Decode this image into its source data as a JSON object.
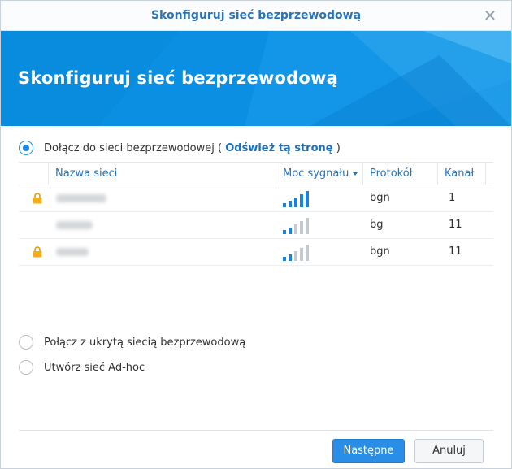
{
  "window": {
    "title": "Skonfiguruj sieć bezprzewodową",
    "close_glyph": "✕"
  },
  "banner": {
    "title": "Skonfiguruj sieć bezprzewodową"
  },
  "options": {
    "join": {
      "label": "Dołącz do sieci bezprzewodowej",
      "paren_open": "(",
      "refresh_link": "Odśwież tą stronę",
      "paren_close": ")",
      "checked": true
    },
    "hidden": {
      "label": "Połącz z ukrytą siecią bezprzewodową",
      "checked": false
    },
    "adhoc": {
      "label": "Utwórz sieć Ad-hoc",
      "checked": false
    }
  },
  "table": {
    "headers": {
      "name": "Nazwa sieci",
      "signal": "Moc sygnału",
      "protocol": "Protokół",
      "channel": "Kanał"
    },
    "rows": [
      {
        "locked": true,
        "signal_bars": 5,
        "protocol": "bgn",
        "channel": "1"
      },
      {
        "locked": false,
        "signal_bars": 2,
        "protocol": "bg",
        "channel": "11"
      },
      {
        "locked": true,
        "signal_bars": 2,
        "protocol": "bgn",
        "channel": "11"
      }
    ]
  },
  "buttons": {
    "next": "Następne",
    "cancel": "Anuluj"
  },
  "colors": {
    "accent": "#2b73b5",
    "banner": "#0a8fe2",
    "lock": "#f0a30a",
    "signal_on": "#1a83d9",
    "signal_off": "#c3cad1"
  },
  "icons": {
    "lock": "padlock-icon",
    "signal": "wifi-signal-bars-icon",
    "close": "close-icon"
  }
}
